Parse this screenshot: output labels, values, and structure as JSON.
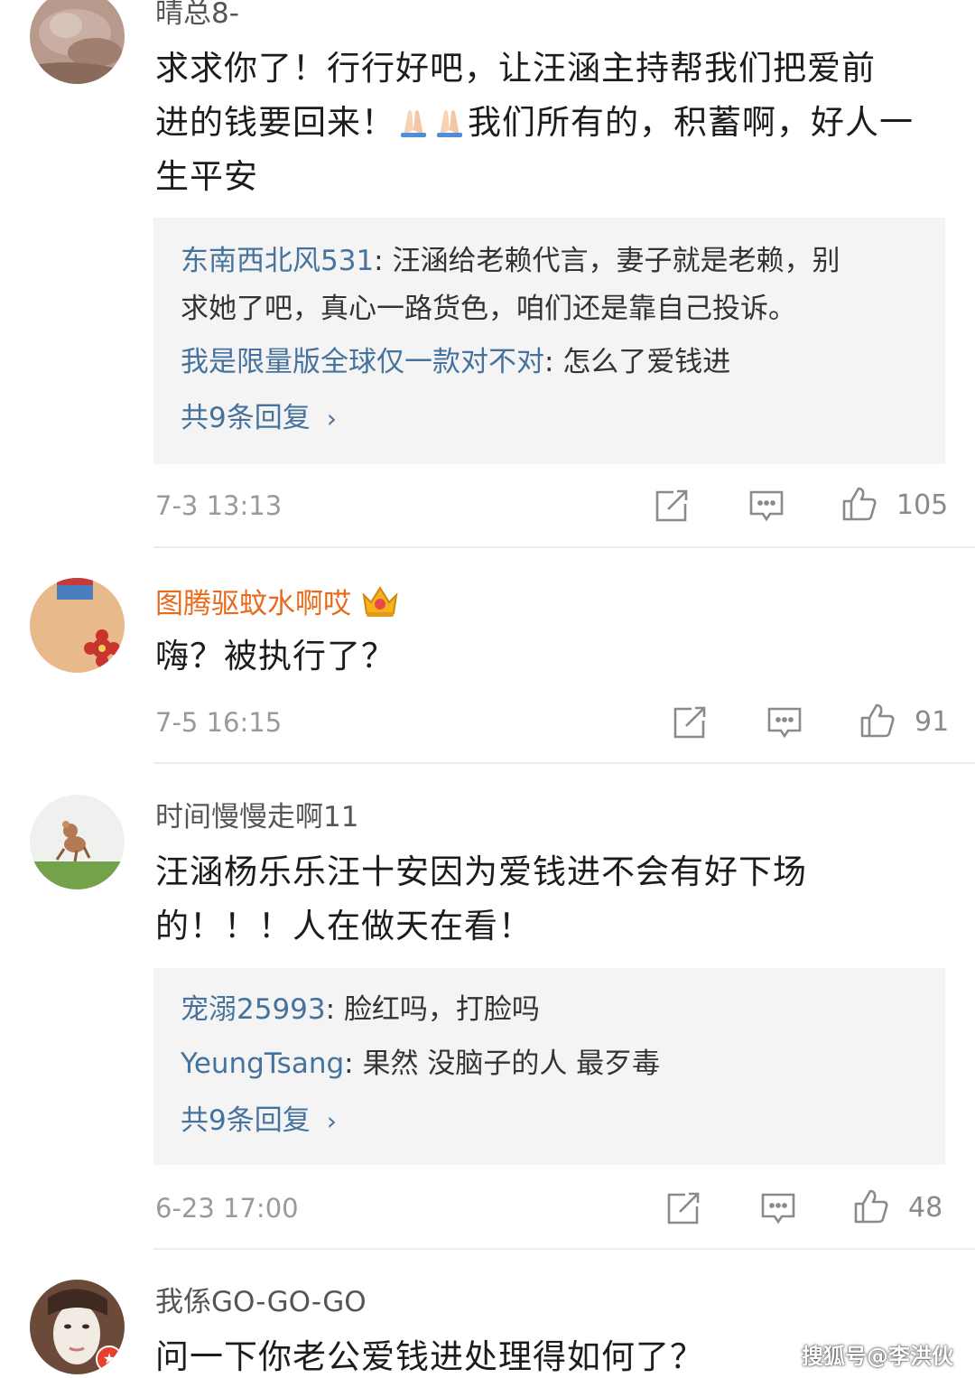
{
  "comments": [
    {
      "username": "晴总8-",
      "content_before": "求求你了！行行好吧，让汪涵主持帮我们把爱前",
      "content_line2a": "进的钱要回来！",
      "emoji": "pray-hands-icon",
      "content_line2b": "我们所有的，积蓄啊，好人一",
      "content_line3": "生平安",
      "replies": [
        {
          "name": "东南西北风531",
          "text": "汪涵给老赖代言，妻子就是老赖，别",
          "text2": "求她了吧，真心一路货色，咱们还是靠自己投诉。"
        },
        {
          "name": "我是限量版全球仅一款对不对",
          "text": "怎么了爱钱进"
        }
      ],
      "more_replies": "共9条回复",
      "time": "7-3 13:13",
      "likes": "105"
    },
    {
      "username": "图腾驱蚊水啊哎",
      "badge": "crown-icon",
      "content": "嗨？被执行了？",
      "time": "7-5 16:15",
      "likes": "91"
    },
    {
      "username": "时间慢慢走啊11",
      "content_line1": "汪涵杨乐乐汪十安因为爱钱进不会有好下场",
      "content_line2": "的！！！人在做天在看！",
      "replies": [
        {
          "name": "宠溺25993",
          "text": "脸红吗，打脸吗"
        },
        {
          "name": "YeungTsang",
          "text": "果然 没脑子的人 最歹毒"
        }
      ],
      "more_replies": "共9条回复",
      "time": "6-23 17:00",
      "likes": "48"
    },
    {
      "username": "我係GO-GO-GO",
      "content": "问一下你老公爱钱进处理得如何了？"
    }
  ],
  "colors": {
    "link_blue": "#46739e",
    "vip_orange": "#e86a1a",
    "reply_bg": "#f4f4f4",
    "meta_gray": "#9a9a9a"
  },
  "watermark": "搜狐号@李洪伙"
}
